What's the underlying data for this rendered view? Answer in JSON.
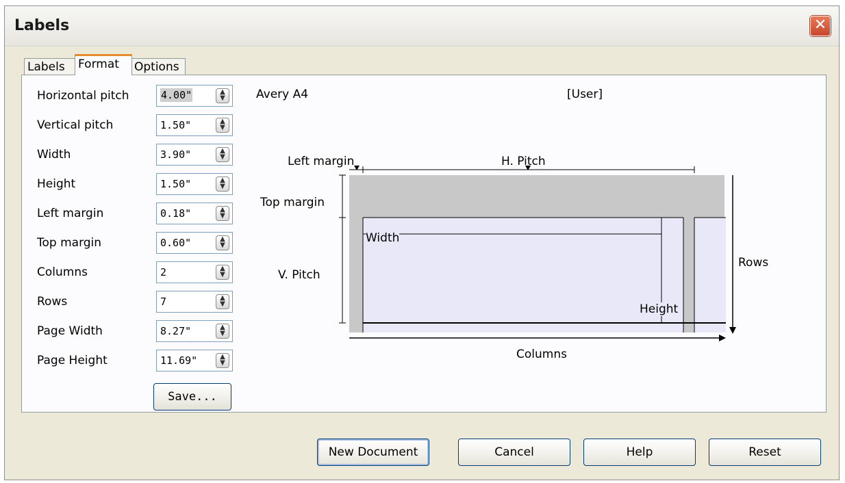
{
  "window": {
    "title": "Labels",
    "close_symbol": "✕"
  },
  "tabs": [
    {
      "label": "Labels",
      "active": false
    },
    {
      "label": "Format",
      "active": true
    },
    {
      "label": "Options",
      "active": false
    }
  ],
  "format": {
    "fields": [
      {
        "label": "Horizontal pitch",
        "value": "4.00\""
      },
      {
        "label": "Vertical pitch",
        "value": "1.50\""
      },
      {
        "label": "Width",
        "value": "3.90\""
      },
      {
        "label": "Height",
        "value": "1.50\""
      },
      {
        "label": "Left margin",
        "value": "0.18\""
      },
      {
        "label": "Top margin",
        "value": "0.60\""
      },
      {
        "label": "Columns",
        "value": "2"
      },
      {
        "label": "Rows",
        "value": "7"
      },
      {
        "label": "Page Width",
        "value": "8.27\""
      },
      {
        "label": "Page Height",
        "value": "11.69\""
      }
    ],
    "save_label": "Save..."
  },
  "preview": {
    "brand": "Avery A4",
    "type": "[User]",
    "labels": {
      "left_margin": "Left margin",
      "h_pitch": "H. Pitch",
      "top_margin": "Top margin",
      "width": "Width",
      "v_pitch": "V. Pitch",
      "rows": "Rows",
      "height": "Height",
      "columns": "Columns"
    }
  },
  "buttons": {
    "new_document": "New Document",
    "cancel": "Cancel",
    "help": "Help",
    "reset": "Reset"
  },
  "colors": {
    "page_margin_gray": "#c8c8c8",
    "label_fill": "#e8e8f8",
    "tab_accent": "#e68b2c"
  }
}
